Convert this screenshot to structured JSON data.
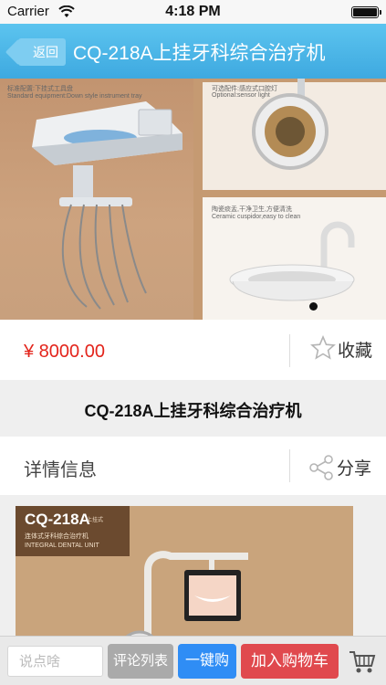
{
  "status_bar": {
    "carrier": "Carrier",
    "time": "4:18 PM"
  },
  "nav": {
    "back_label": "返回",
    "title": "CQ-218A上挂牙科综合治疗机"
  },
  "banner": {
    "caption_tray_cn": "标准配置:下挂式工具盘",
    "caption_tray_en": "Standard equipment:Down style instrument tray",
    "caption_light_cn": "可选配件:感应式口腔灯",
    "caption_light_en": "Optional:sensor light",
    "caption_cuspidor_cn": "陶瓷痰盂,干净卫生,方便清洗",
    "caption_cuspidor_en": "Ceramic cuspidor,easy to clean",
    "slide_count": 1,
    "active_slide": 1
  },
  "product": {
    "price": "¥ 8000.00",
    "favorite_label": "收藏",
    "title": "CQ-218A上挂牙科综合治疗机"
  },
  "details": {
    "label": "详情信息",
    "share_label": "分享",
    "image_model": "CQ-218A",
    "image_model_suffix": "上挂式",
    "image_subtitle": "连体式牙科综合治疗机",
    "image_en": "INTEGRAL DENTAL UNIT"
  },
  "bottom_bar": {
    "comment_placeholder": "说点啥",
    "reviews_label": "评论列表",
    "buy_now_label": "一键购",
    "add_to_cart_label": "加入购物车"
  },
  "colors": {
    "nav_blue": "#4cb8e8",
    "price_red": "#e3241b",
    "buy_blue": "#2f8df5",
    "cart_red": "#e0494e",
    "reviews_gray": "#aaaaaa"
  },
  "icons": [
    "wifi-icon",
    "battery-icon",
    "back-arrow-icon",
    "star-icon",
    "share-icon",
    "cart-icon"
  ]
}
